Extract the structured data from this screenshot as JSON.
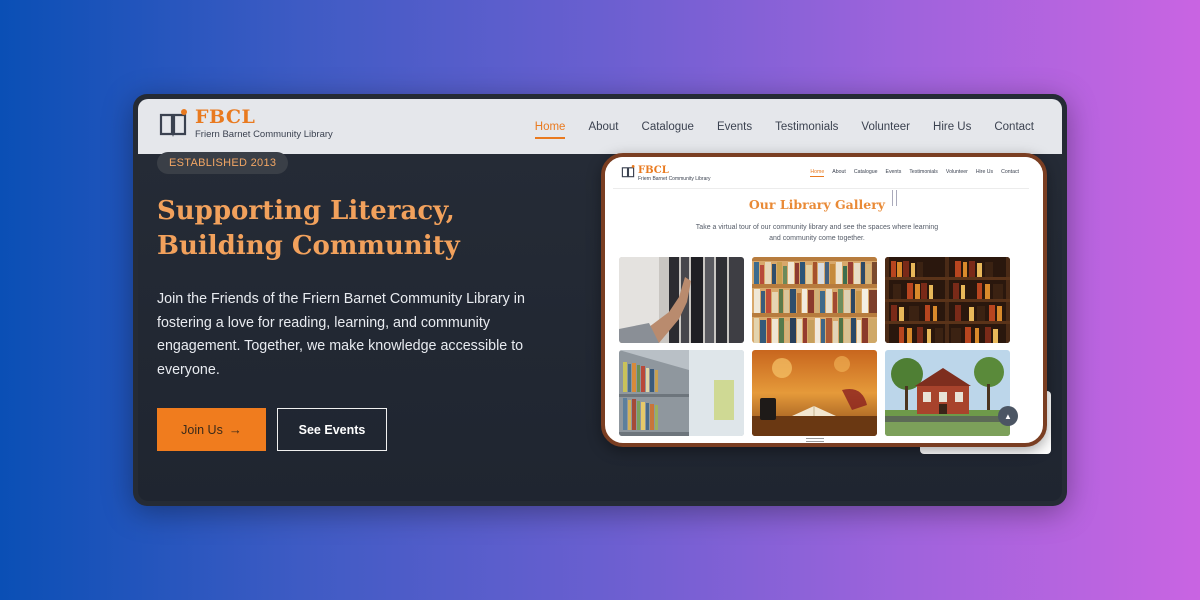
{
  "brand": {
    "logo_icon": "open-book-icon",
    "title": "FBCL",
    "subtitle": "Friern Barnet Community Library"
  },
  "nav": {
    "items": [
      "Home",
      "About",
      "Catalogue",
      "Events",
      "Testimonials",
      "Volunteer",
      "Hire Us",
      "Contact"
    ],
    "active": "Home"
  },
  "hero": {
    "badge": "ESTABLISHED 2013",
    "headline_line1": "Supporting Literacy,",
    "headline_line2": "Building Community",
    "lead": "Join the Friends of the Friern Barnet Community Library in fostering a love for reading, learning, and community engagement. Together, we make knowledge accessible to everyone.",
    "primary_button": "Join Us",
    "primary_button_icon": "arrow-right-icon",
    "secondary_button": "See Events"
  },
  "preview": {
    "gallery_title": "Our Library Gallery",
    "gallery_text_line1": "Take a virtual tour of our community library and see the spaces where learning",
    "gallery_text_line2": "and community come together.",
    "scroll_top_icon": "chevron-up-icon",
    "images": [
      "hand-reaching-bookshelf",
      "shelves-of-books",
      "dark-wood-bookcase",
      "library-aisle",
      "open-book-on-table",
      "red-brick-library-building"
    ]
  },
  "colors": {
    "accent": "#f07c1e",
    "heading": "#f2a15c",
    "dark_bg": "#252b35",
    "nav_bg": "#e5e7eb"
  }
}
